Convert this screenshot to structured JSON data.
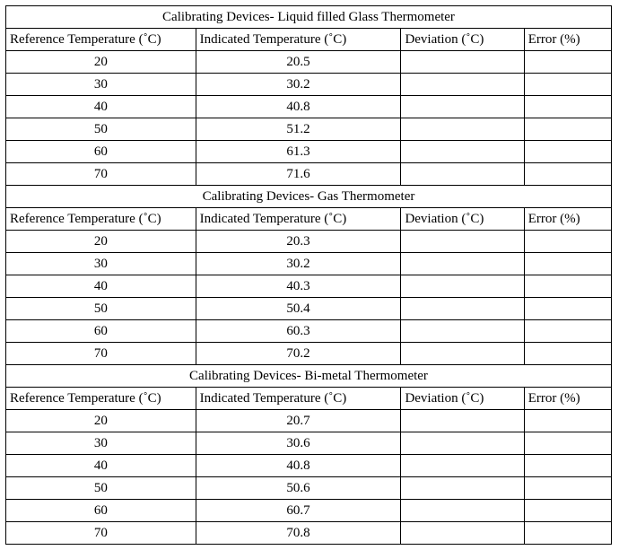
{
  "columns": {
    "ref": "Reference Temperature (˚C)",
    "ind": "Indicated Temperature (˚C)",
    "dev": "Deviation (˚C)",
    "err": "Error (%)"
  },
  "sections": [
    {
      "title": "Calibrating Devices- Liquid filled Glass Thermometer",
      "rows": [
        {
          "ref": "20",
          "ind": "20.5",
          "dev": "",
          "err": ""
        },
        {
          "ref": "30",
          "ind": "30.2",
          "dev": "",
          "err": ""
        },
        {
          "ref": "40",
          "ind": "40.8",
          "dev": "",
          "err": ""
        },
        {
          "ref": "50",
          "ind": "51.2",
          "dev": "",
          "err": ""
        },
        {
          "ref": "60",
          "ind": "61.3",
          "dev": "",
          "err": ""
        },
        {
          "ref": "70",
          "ind": "71.6",
          "dev": "",
          "err": ""
        }
      ]
    },
    {
      "title": "Calibrating Devices- Gas Thermometer",
      "rows": [
        {
          "ref": "20",
          "ind": "20.3",
          "dev": "",
          "err": ""
        },
        {
          "ref": "30",
          "ind": "30.2",
          "dev": "",
          "err": ""
        },
        {
          "ref": "40",
          "ind": "40.3",
          "dev": "",
          "err": ""
        },
        {
          "ref": "50",
          "ind": "50.4",
          "dev": "",
          "err": ""
        },
        {
          "ref": "60",
          "ind": "60.3",
          "dev": "",
          "err": ""
        },
        {
          "ref": "70",
          "ind": "70.2",
          "dev": "",
          "err": ""
        }
      ]
    },
    {
      "title": "Calibrating Devices- Bi-metal Thermometer",
      "rows": [
        {
          "ref": "20",
          "ind": "20.7",
          "dev": "",
          "err": ""
        },
        {
          "ref": "30",
          "ind": "30.6",
          "dev": "",
          "err": ""
        },
        {
          "ref": "40",
          "ind": "40.8",
          "dev": "",
          "err": ""
        },
        {
          "ref": "50",
          "ind": "50.6",
          "dev": "",
          "err": ""
        },
        {
          "ref": "60",
          "ind": "60.7",
          "dev": "",
          "err": ""
        },
        {
          "ref": "70",
          "ind": "70.8",
          "dev": "",
          "err": ""
        }
      ]
    }
  ]
}
